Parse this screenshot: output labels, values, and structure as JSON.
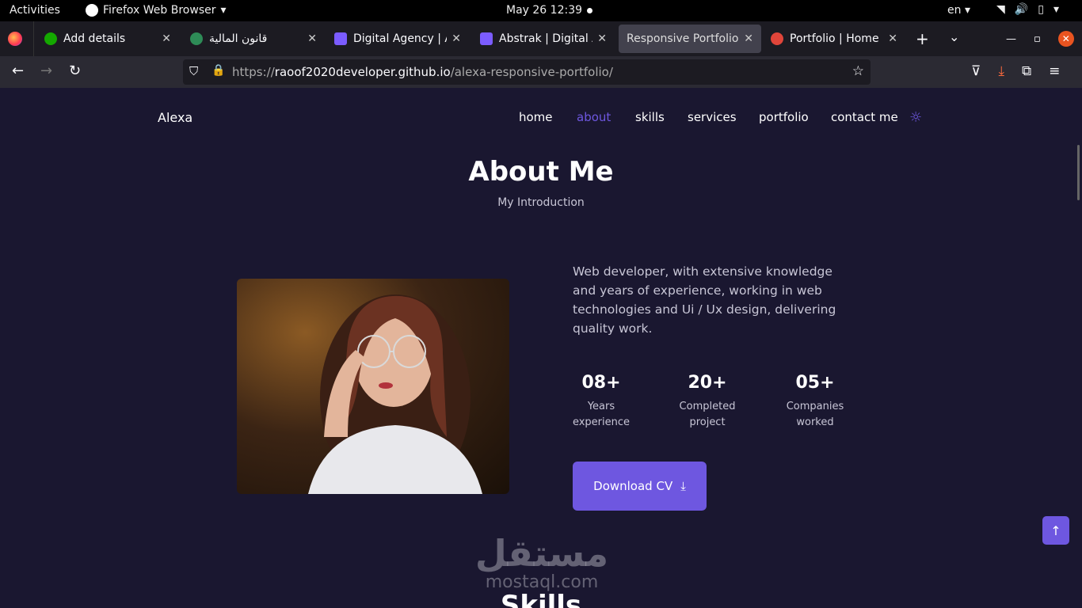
{
  "system": {
    "activities": "Activities",
    "app_name": "Firefox Web Browser",
    "clock": "May 26  12:39",
    "lang": "en"
  },
  "tabs": [
    {
      "label": "Add details",
      "fav_color": "#14a800"
    },
    {
      "label": "قانون المالية",
      "fav_color": "#2e8b57"
    },
    {
      "label": "Digital Agency | Ab",
      "fav_color": "#7b5cff"
    },
    {
      "label": "Abstrak | Digital Ag",
      "fav_color": "#7b5cff"
    },
    {
      "label": "Responsive Portfolio W",
      "fav_color": ""
    },
    {
      "label": "Portfolio | Home",
      "fav_color": "#e0453a"
    }
  ],
  "address": {
    "scheme": "https://",
    "host": "raoof2020developer.github.io",
    "path": "/alexa-responsive-portfolio/"
  },
  "site": {
    "brand": "Alexa",
    "menu": [
      "home",
      "about",
      "skills",
      "services",
      "portfolio",
      "contact me"
    ],
    "active_menu": "about",
    "accent": "#6e57e0"
  },
  "about": {
    "title": "About Me",
    "subtitle": "My Introduction",
    "description": "Web developer, with extensive knowledge and years of experience, working in web technologies and Ui / Ux design, delivering quality work.",
    "stats": [
      {
        "value": "08+",
        "caption_1": "Years",
        "caption_2": "experience"
      },
      {
        "value": "20+",
        "caption_1": "Completed",
        "caption_2": "project"
      },
      {
        "value": "05+",
        "caption_1": "Companies",
        "caption_2": "worked"
      }
    ],
    "cv_button": "Download CV"
  },
  "next_section_title": "Skills",
  "watermark": {
    "arabic": "مستقل",
    "latin": "mostaql.com"
  }
}
